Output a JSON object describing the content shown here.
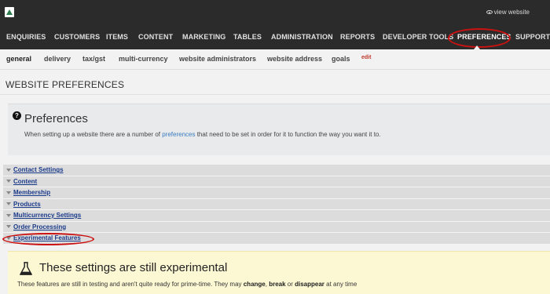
{
  "topbar": {
    "view_website": "view website"
  },
  "main_nav": [
    {
      "label": "ENQUIRIES"
    },
    {
      "label": "CUSTOMERS"
    },
    {
      "label": "ITEMS"
    },
    {
      "label": "CONTENT"
    },
    {
      "label": "MARKETING"
    },
    {
      "label": "TABLES"
    },
    {
      "label": "ADMINISTRATION"
    },
    {
      "label": "REPORTS"
    },
    {
      "label": "DEVELOPER TOOLS"
    },
    {
      "label": "PREFERENCES",
      "active": true
    },
    {
      "label": "SUPPORT"
    }
  ],
  "sub_nav": [
    {
      "label": "general",
      "active": true
    },
    {
      "label": "delivery"
    },
    {
      "label": "tax/gst"
    },
    {
      "label": "multi-currency"
    },
    {
      "label": "website administrators"
    },
    {
      "label": "website address"
    },
    {
      "label": "goals"
    }
  ],
  "sub_nav_edit": "edit",
  "page": {
    "title": "WEBSITE PREFERENCES"
  },
  "preferences_box": {
    "title": "Preferences",
    "desc_before": "When setting up a website there are a number of ",
    "desc_link": "preferences",
    "desc_after": " that need to be set in order for it to function the way you want it to."
  },
  "accordion": [
    {
      "label": "Contact Settings"
    },
    {
      "label": "Content"
    },
    {
      "label": "Membership"
    },
    {
      "label": "Products"
    },
    {
      "label": "Multicurrency Settings"
    },
    {
      "label": "Order Processing"
    },
    {
      "label": "Experimental Features"
    }
  ],
  "experimental": {
    "title": "These settings are still experimental",
    "desc_1": "These features are still in testing and aren't quite ready for prime-time. They may ",
    "word_change": "change",
    "sep_1": ", ",
    "word_break": "break",
    "sep_2": " or ",
    "word_disappear": "disappear",
    "desc_2": " at any time"
  },
  "colors": {
    "highlight_oval": "#cc1111",
    "topbar": "#2b2b2b",
    "accent_link": "#3b7bbf"
  }
}
